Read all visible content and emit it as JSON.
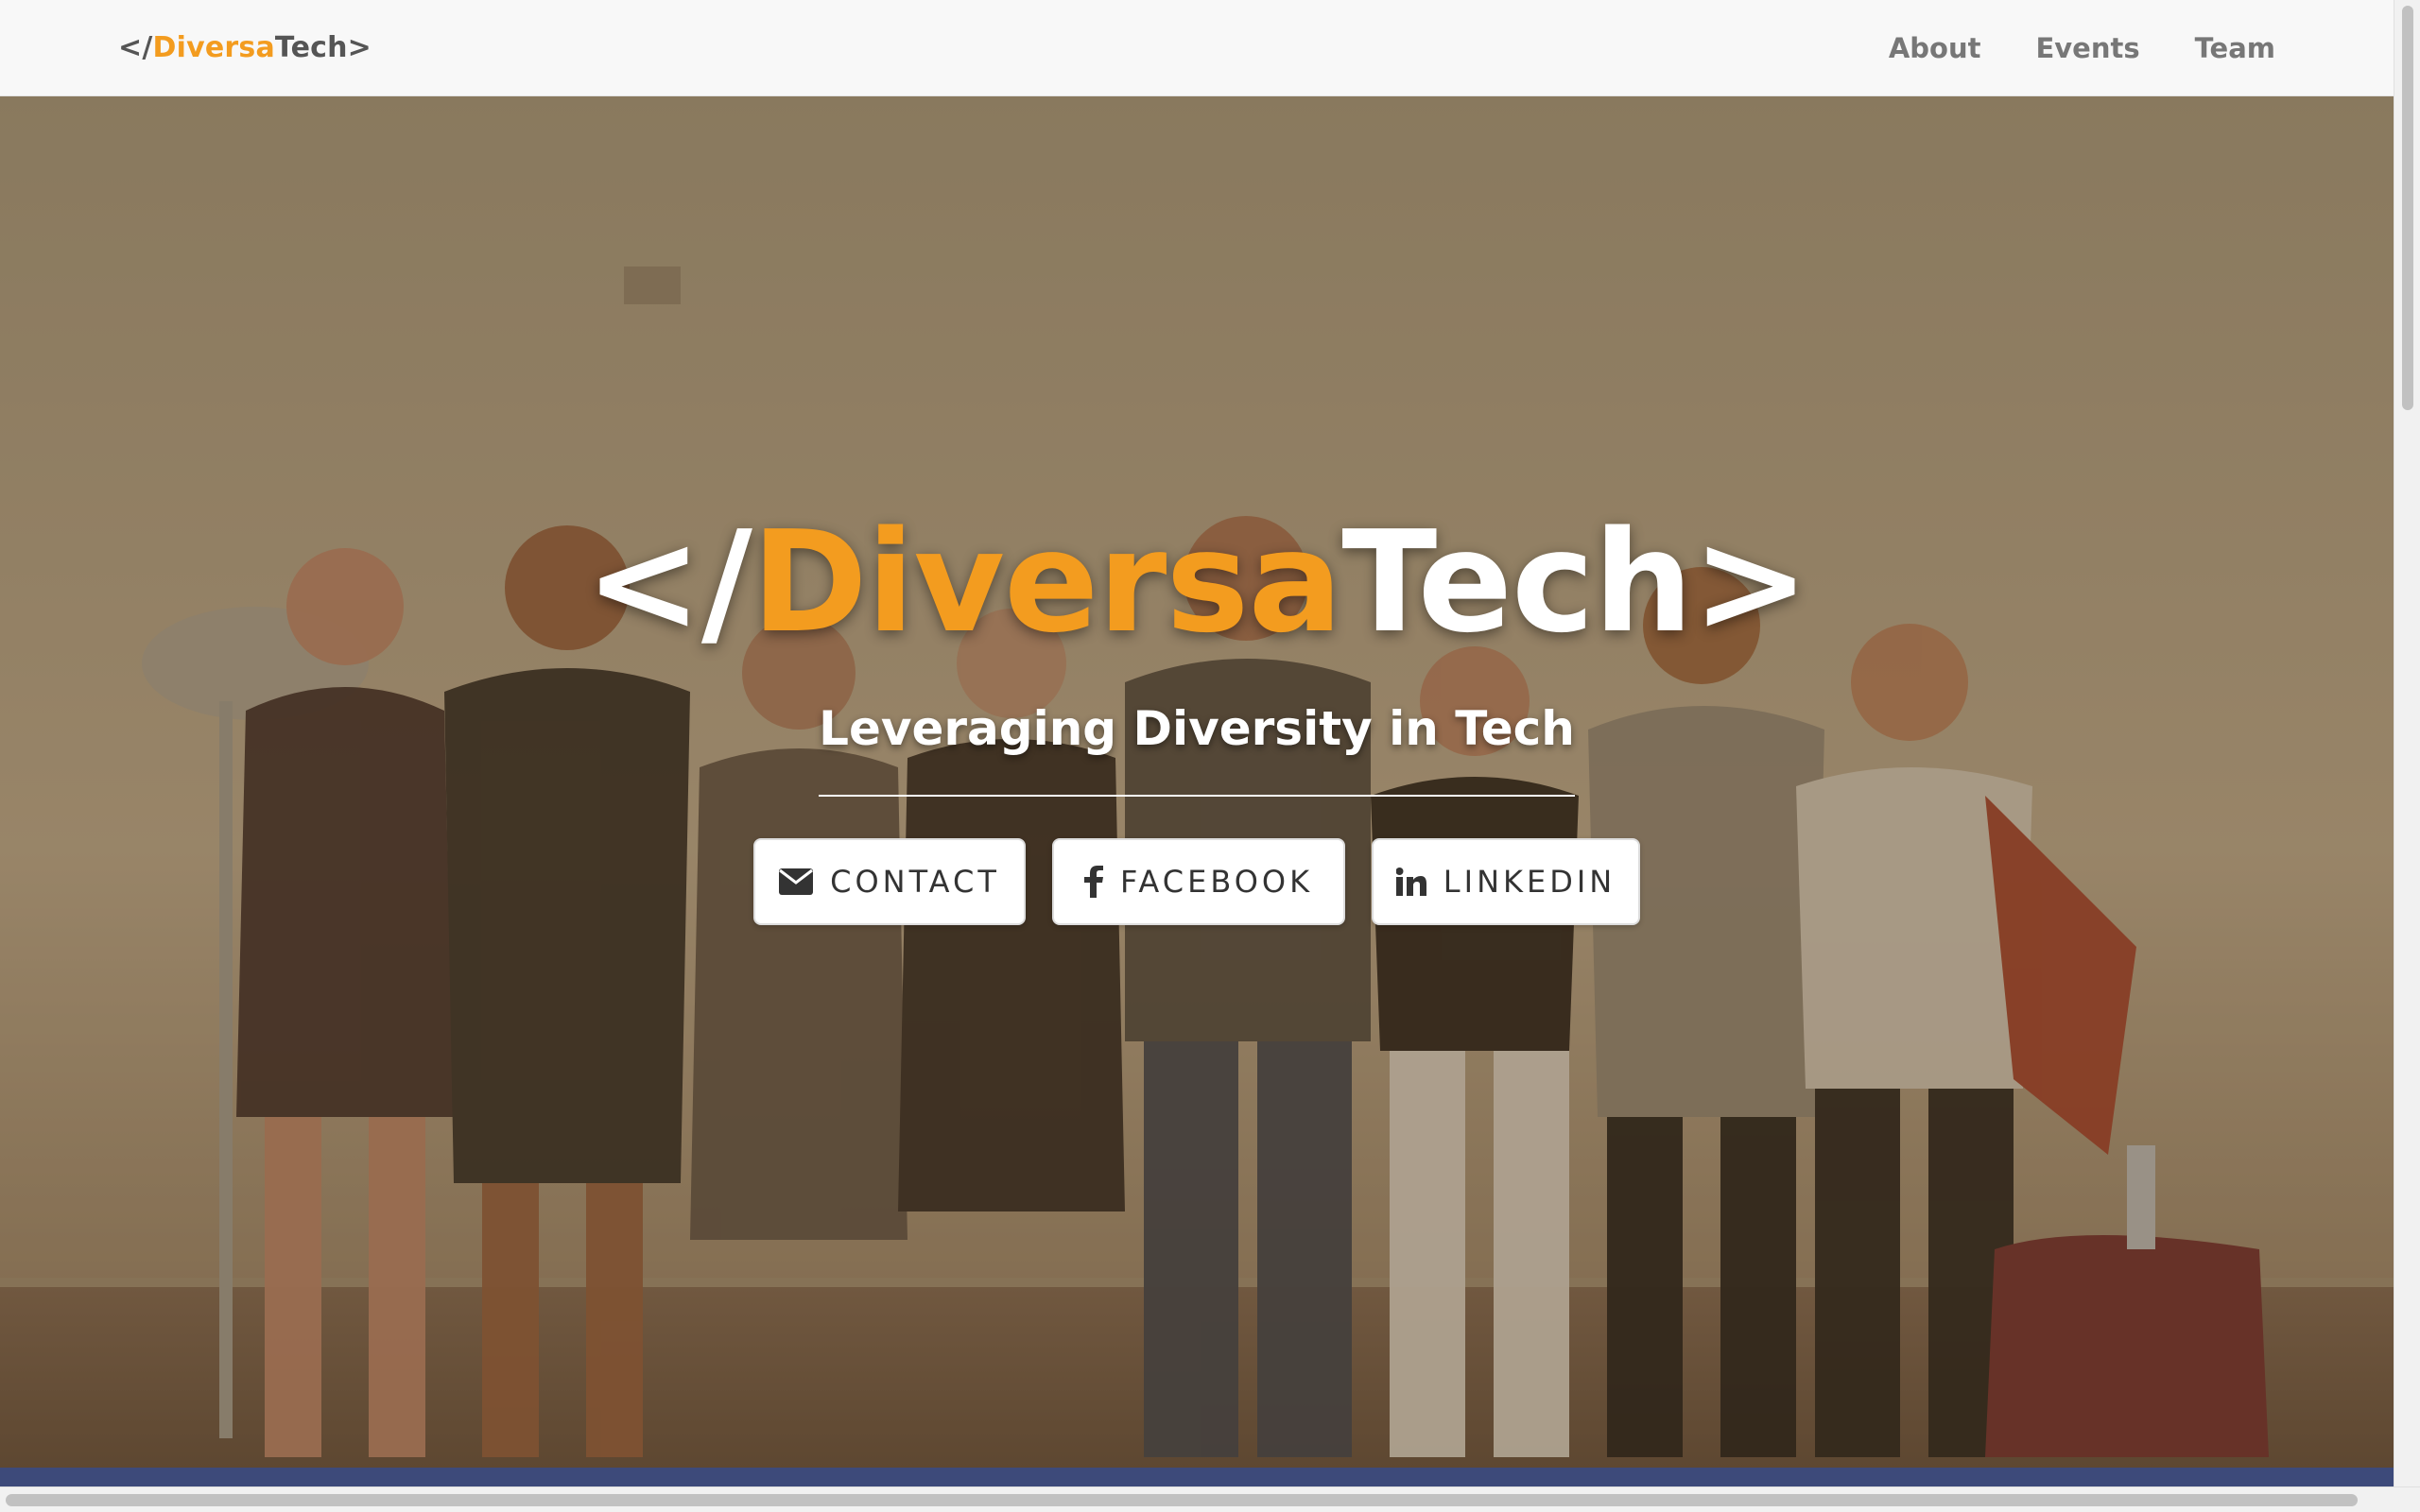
{
  "navbar": {
    "brand_prefix": "</",
    "brand_accent": "Diversa",
    "brand_suffix": "Tech>",
    "links": [
      {
        "label": "About"
      },
      {
        "label": "Events"
      },
      {
        "label": "Team"
      }
    ]
  },
  "hero": {
    "title_prefix": "</",
    "title_accent": "Diversa",
    "title_suffix": "Tech>",
    "subtitle": "Leveraging Diversity in Tech",
    "buttons": [
      {
        "label": "CONTACT",
        "icon": "envelope-icon"
      },
      {
        "label": "FACEBOOK",
        "icon": "facebook-icon"
      },
      {
        "label": "LINKEDIN",
        "icon": "linkedin-icon"
      }
    ]
  },
  "colors": {
    "accent": "#f39c1f",
    "navbar_bg": "#f8f8f8",
    "nav_text": "#777777",
    "hero_tint": "#5f441c"
  }
}
